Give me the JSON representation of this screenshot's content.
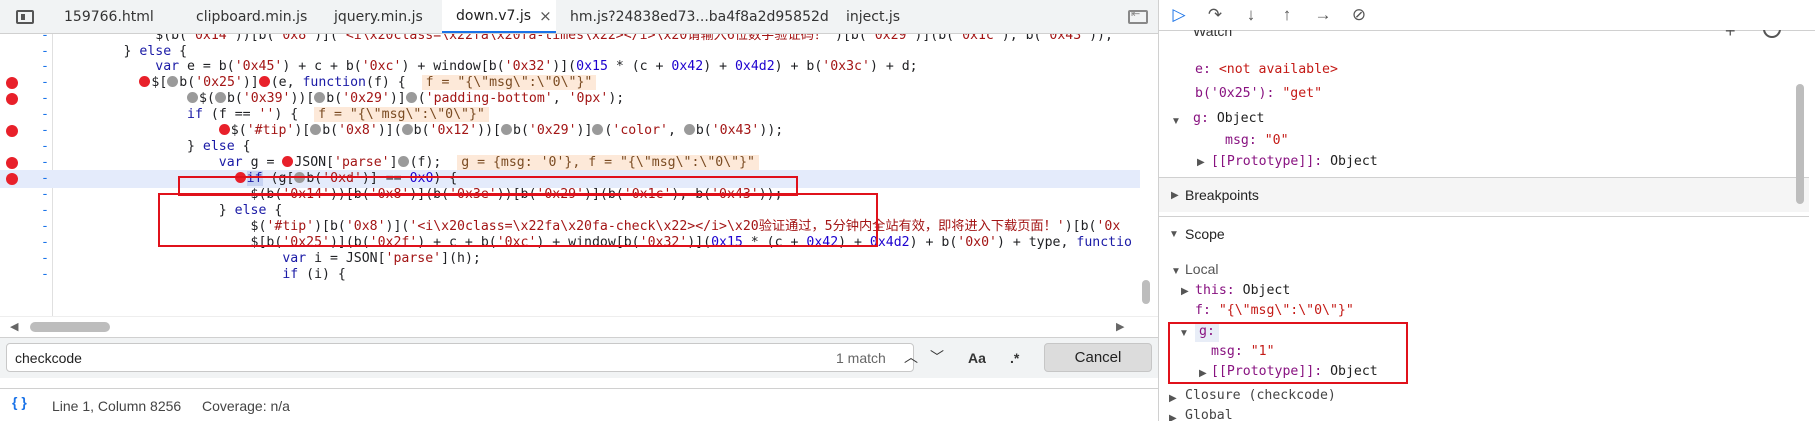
{
  "tabs": [
    "159766.html",
    "clipboard.min.js",
    "jquery.min.js",
    "down.v7.js",
    "hm.js?24838ed73...ba4f8a2d95852d",
    "inject.js"
  ],
  "active_tab_close": "×",
  "editor": {
    "lines": [
      {
        "bp": false,
        "hl": false
      },
      {
        "bp": false,
        "hl": false
      },
      {
        "bp": false,
        "hl": false
      },
      {
        "bp": true,
        "hl": false
      },
      {
        "bp": true,
        "hl": false
      },
      {
        "bp": false,
        "hl": false
      },
      {
        "bp": true,
        "hl": false
      },
      {
        "bp": false,
        "hl": false
      },
      {
        "bp": true,
        "hl": false
      },
      {
        "bp": true,
        "hl": true
      },
      {
        "bp": false,
        "hl": false
      },
      {
        "bp": false,
        "hl": false
      },
      {
        "bp": false,
        "hl": false
      },
      {
        "bp": false,
        "hl": false
      },
      {
        "bp": false,
        "hl": false
      },
      {
        "bp": false,
        "hl": false
      }
    ],
    "gutter_mark": "-"
  },
  "search": {
    "value": "checkcode",
    "match": "1 match",
    "case": "Aa",
    "regex": ".*",
    "cancel": "Cancel"
  },
  "status": {
    "braces": "{ }",
    "position": "Line 1, Column 8256",
    "coverage": "Coverage: n/a"
  },
  "watch": {
    "title": "Watch",
    "e_key": "e:",
    "e_val": "<not available>",
    "b_key": "b('0x25'):",
    "b_val": "\"get\"",
    "g_key": "g:",
    "g_val": "Object",
    "msg_key": "msg:",
    "msg_val": "\"0\"",
    "proto_key": "[[Prototype]]:",
    "proto_val": "Object"
  },
  "breakpoints": "Breakpoints",
  "scope": {
    "title": "Scope",
    "local": "Local",
    "this_key": "this:",
    "this_val": "Object",
    "f_key": "f:",
    "f_val": "\"{\\\"msg\\\":\\\"0\\\"}\"",
    "g_key": "g:",
    "msg_key": "msg:",
    "msg_val": "\"1\"",
    "proto_key": "[[Prototype]]:",
    "proto_val": "Object",
    "closure": "Closure (checkcode)",
    "global": "Global"
  },
  "colors": {
    "accent": "#1a73e8",
    "breakpoint": "#e8202a",
    "highlight_box": "#e0111b"
  }
}
